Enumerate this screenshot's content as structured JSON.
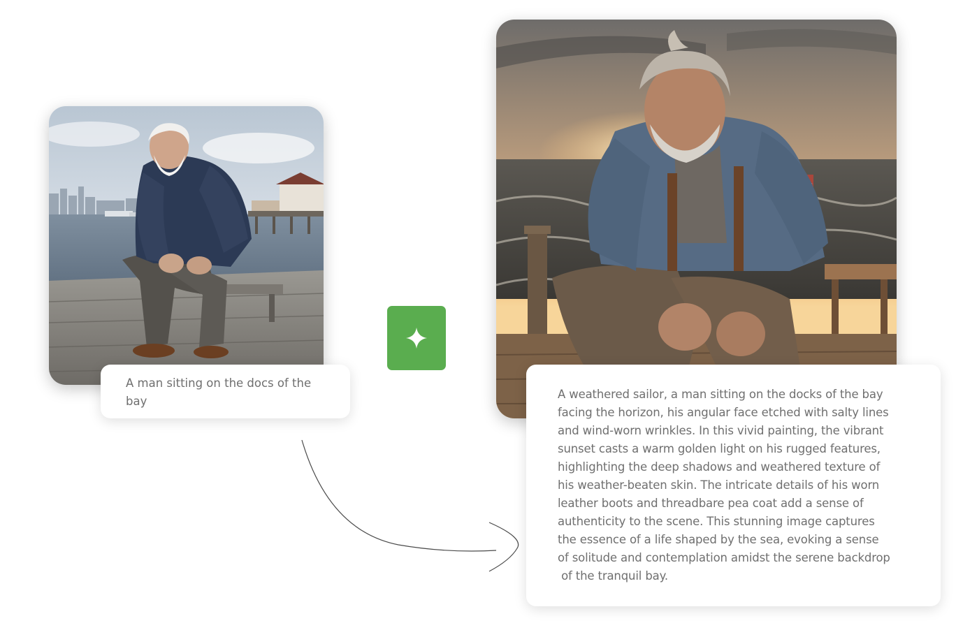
{
  "input": {
    "image_icon": "photo-old-man-on-dock",
    "caption": "A man sitting on the docs of the bay"
  },
  "generate_button": {
    "icon": "sparkle-icon",
    "color": "#5aad4f"
  },
  "output": {
    "image_icon": "painting-weathered-sailor-sunset",
    "caption_lines": [
      "A weathered sailor, a man sitting on the docks of the bay",
      "facing the horizon, his angular face etched with salty lines",
      "and wind-worn wrinkles. In this vivid painting, the vibrant",
      "sunset casts a warm golden light on his rugged features,",
      "highlighting the deep shadows and weathered texture of",
      "his weather-beaten skin. The intricate details of his worn",
      "leather boots and threadbare pea coat add a sense of",
      "authenticity to the scene. This stunning image captures",
      "the essence of a life shaped by the sea, evoking a sense",
      "of solitude and contemplation amidst the serene backdrop",
      " of the tranquil bay."
    ]
  }
}
